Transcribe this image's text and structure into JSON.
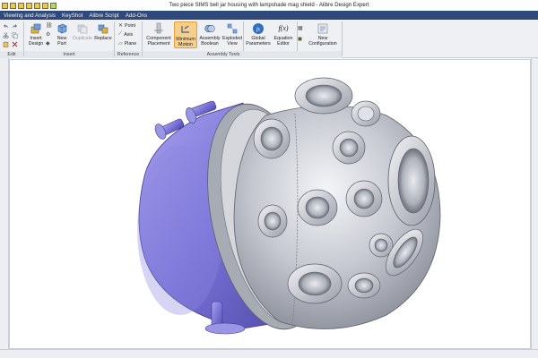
{
  "window": {
    "title": "Two piece SIMS bell jar housing with lampshade mag shield - Alibre Design Expert"
  },
  "menu": {
    "items": [
      "Viewing and Analysis",
      "KeyShot",
      "Alibre Script",
      "Add-Ons"
    ]
  },
  "ribbon": {
    "groups": {
      "edit": "Edit",
      "insert": "Insert",
      "reference": "Reference",
      "assembly_tools": "Assembly Tools"
    },
    "buttons": {
      "insert_design": "Insert\nDesign",
      "new_part": "New\nPart",
      "duplicate": "Duplicate",
      "replace": "Replace",
      "point": "Point",
      "axis": "Axis",
      "plane": "Plane",
      "component_placement": "Component\nPlacement",
      "minimum_motion": "Minimum\nMotion",
      "assembly_boolean": "Assembly\nBoolean",
      "exploded_view": "Exploded\nView",
      "global_parameters": "Global\nParameters",
      "equation_editor": "Equation\nEditor",
      "new_configuration": "New\nConfiguration"
    },
    "icons": {
      "equation": "f(x)",
      "global": "fx"
    }
  },
  "colors": {
    "menubar": "#2f4a7a",
    "accent_active": "#f7cf8a",
    "model_steel": "#b8bcc6",
    "model_violet": "#7a74d8"
  }
}
